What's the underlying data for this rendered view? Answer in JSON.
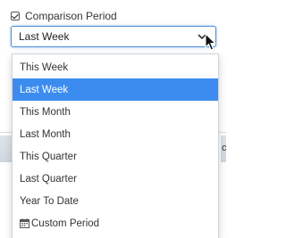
{
  "comparison": {
    "checkbox_label": "Comparison Period",
    "checked": true,
    "selected_value": "Last Week"
  },
  "dropdown": {
    "options": [
      {
        "label": "This Week"
      },
      {
        "label": "Last Week"
      },
      {
        "label": "This Month"
      },
      {
        "label": "Last Month"
      },
      {
        "label": "This Quarter"
      },
      {
        "label": "Last Quarter"
      },
      {
        "label": "Year To Date"
      },
      {
        "label": "Custom Period",
        "icon": "calendar-icon"
      }
    ]
  },
  "background": {
    "partial_text": "c"
  },
  "colors": {
    "accent": "#3c8cf0",
    "border_focus": "#4a90d9"
  }
}
